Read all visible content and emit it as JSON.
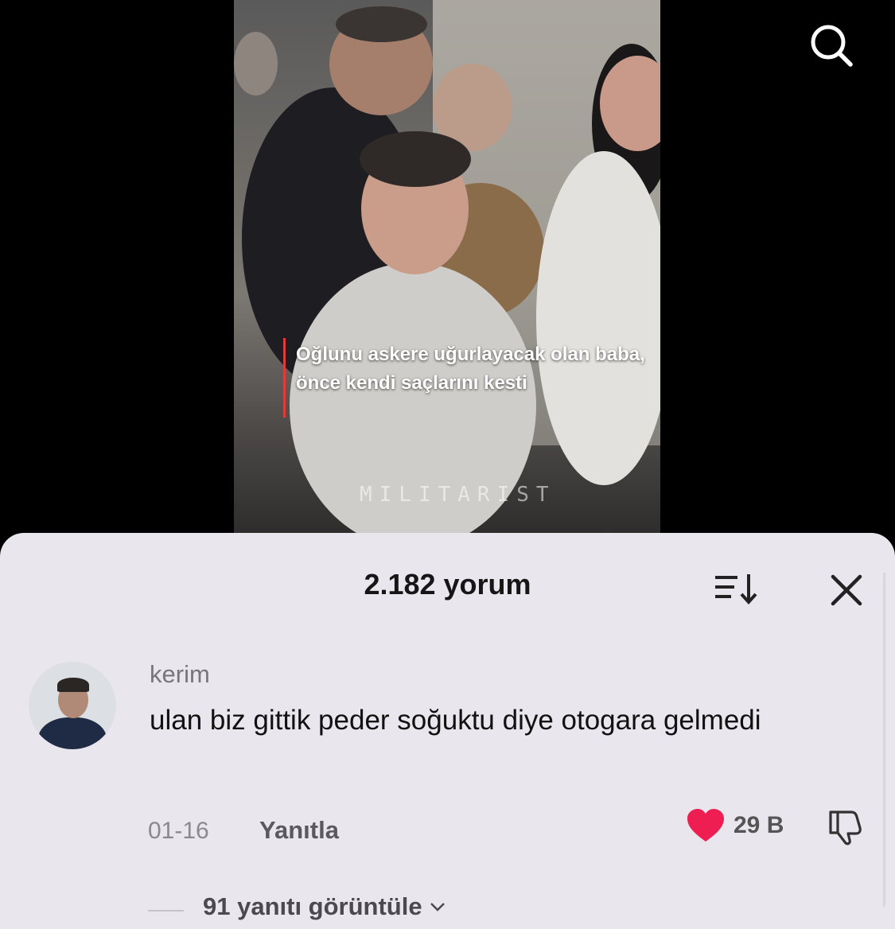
{
  "video": {
    "caption": "Oğlunu askere uğurlayacak olan baba, önce kendi saçlarını kesti",
    "watermark": "MILITARIST"
  },
  "icons": {
    "search": "search-icon",
    "sort": "sort-icon",
    "close": "close-icon",
    "like": "heart-icon",
    "dislike": "thumbs-down-icon",
    "expand": "chevron-down-icon"
  },
  "colors": {
    "sheet_bg": "#e9e7ed",
    "like_red": "#ee1d52"
  },
  "comments_sheet": {
    "title": "2.182 yorum",
    "comment": {
      "username": "kerim",
      "text": "ulan biz gittik peder soğuktu diye otogara gelmedi",
      "date": "01-16",
      "reply_label": "Yanıtla",
      "like_count": "29 B",
      "view_replies": "91 yanıtı görüntüle"
    }
  }
}
